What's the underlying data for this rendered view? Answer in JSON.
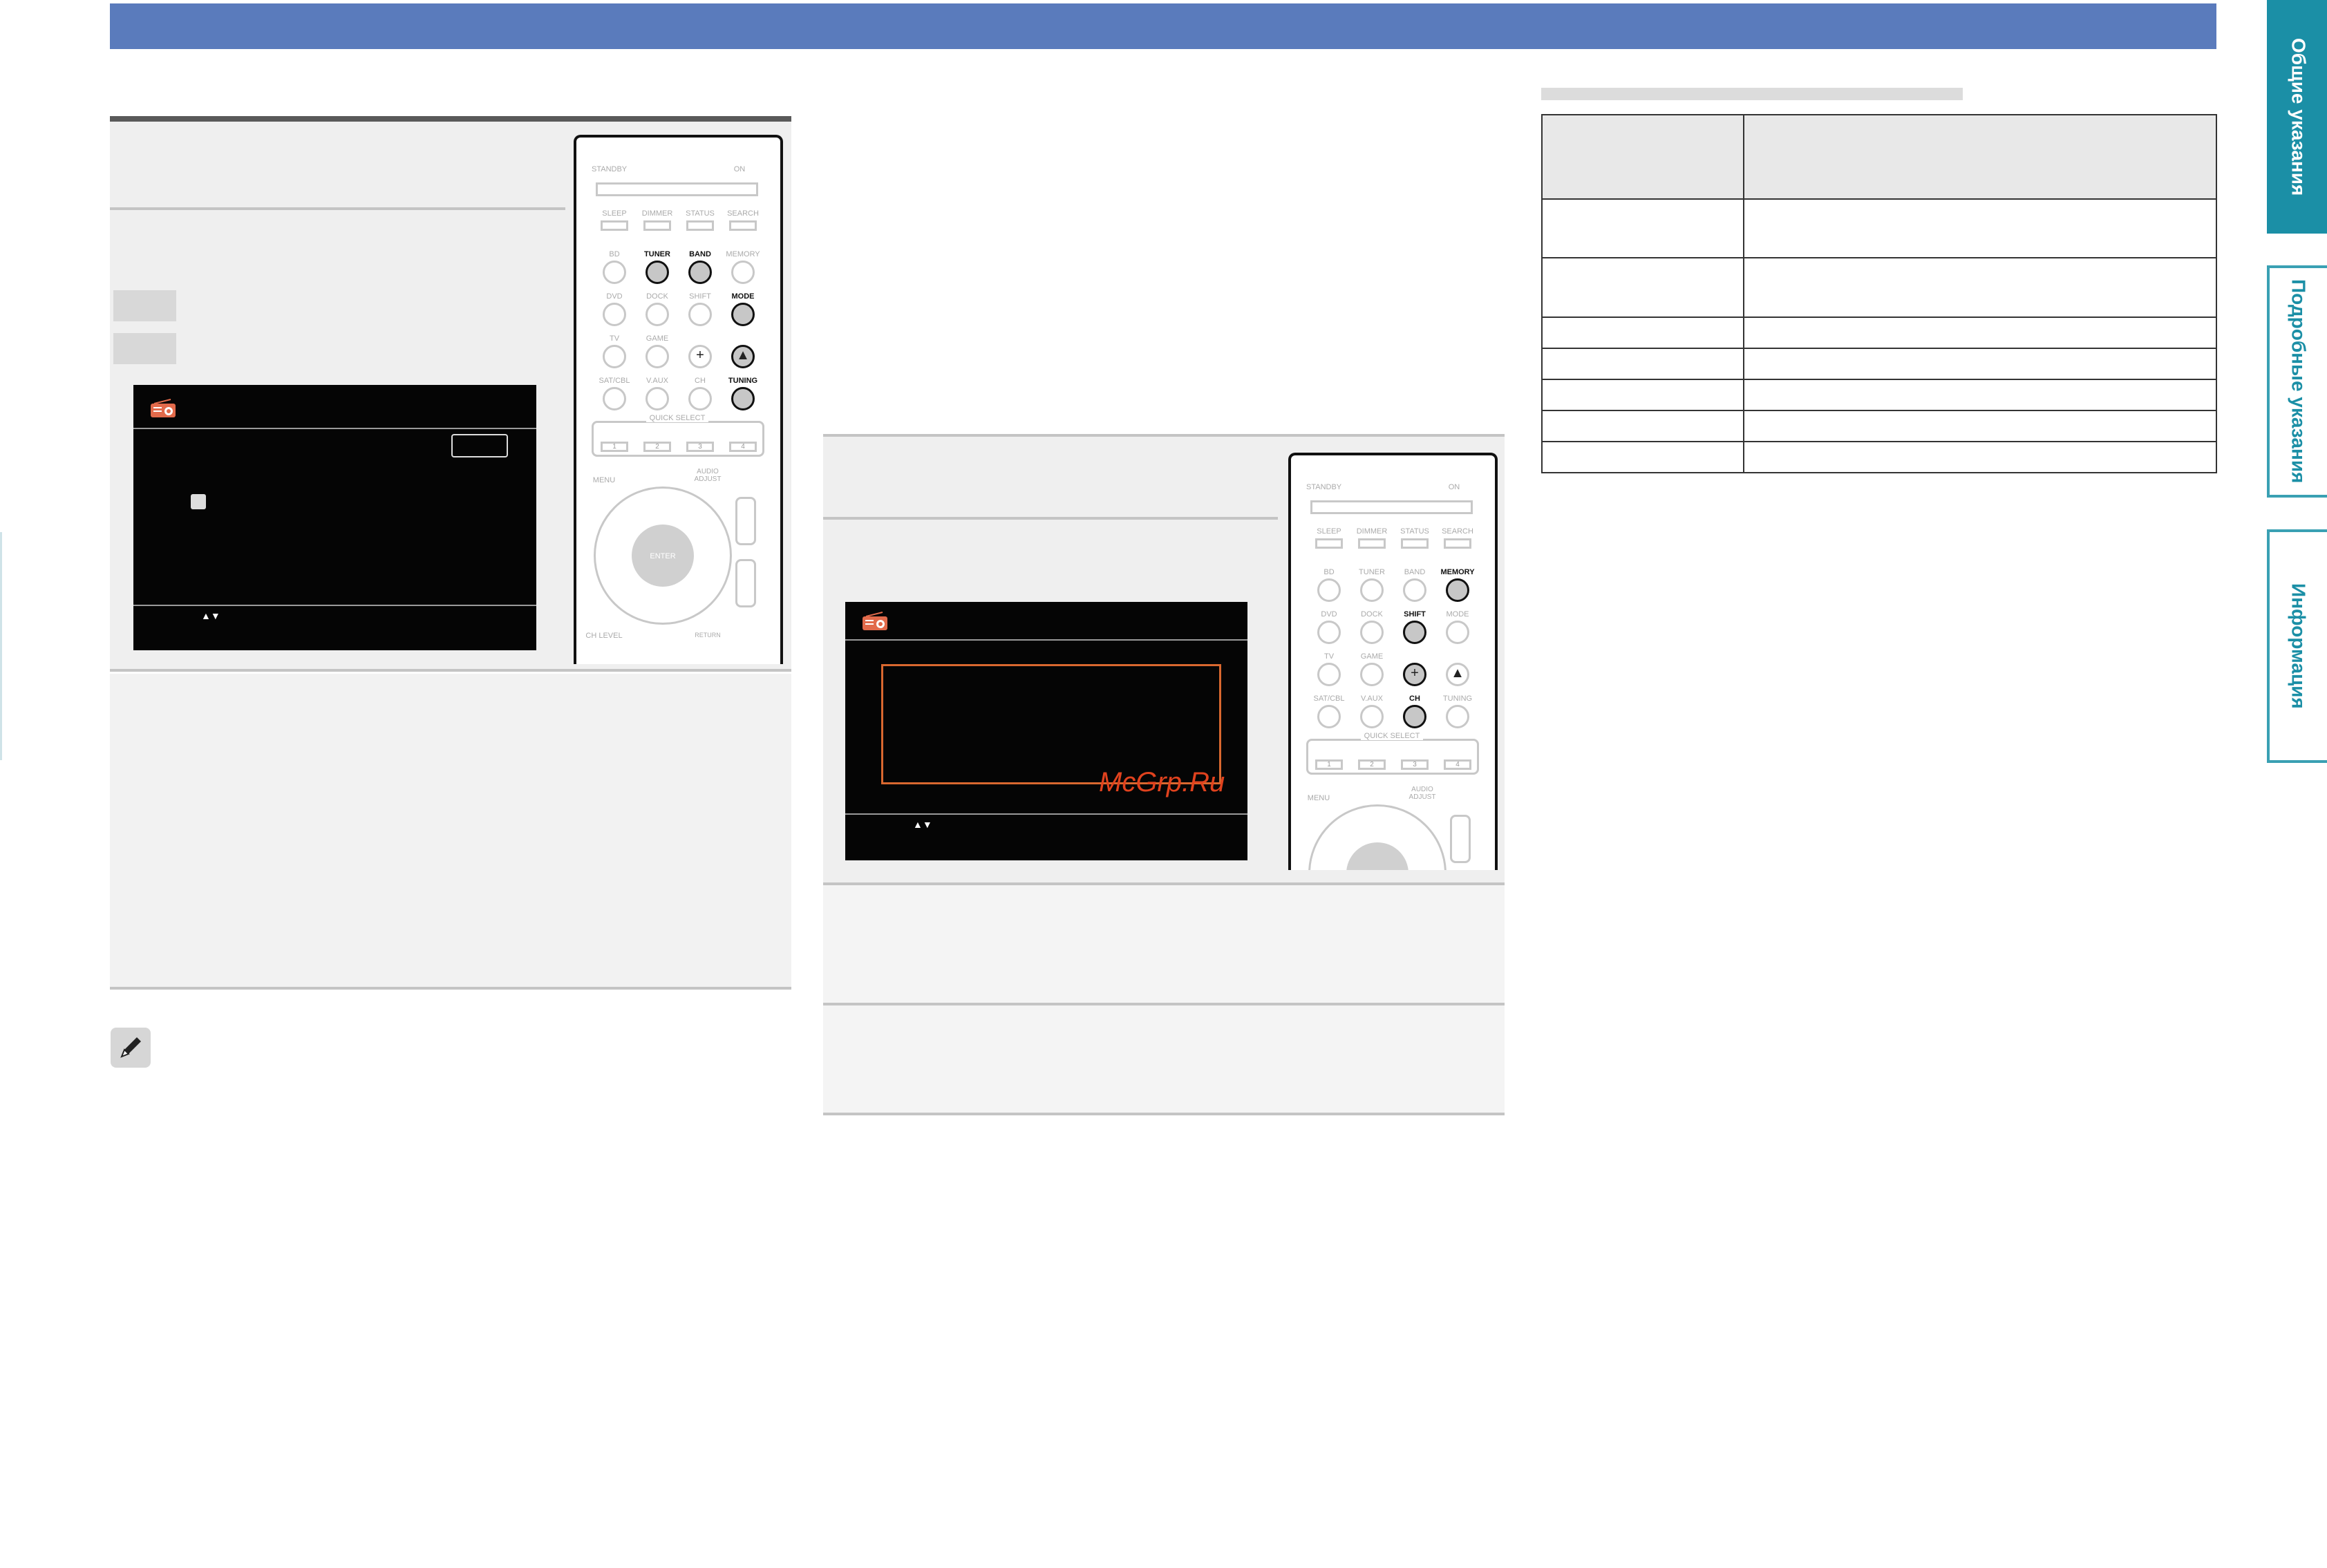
{
  "side_tabs": [
    {
      "label": "Общие указания",
      "active": true
    },
    {
      "label": "Подробные указания",
      "active": false
    },
    {
      "label": "Информация",
      "active": false
    }
  ],
  "remote_left": {
    "top_labels": {
      "standby": "STANDBY",
      "on": "ON"
    },
    "row_labels": [
      "SLEEP",
      "DIMMER",
      "STATUS",
      "SEARCH"
    ],
    "buttons": [
      {
        "label": "BD",
        "hl": false
      },
      {
        "label": "TUNER",
        "hl": true
      },
      {
        "label": "BAND",
        "hl": true
      },
      {
        "label": "MEMORY",
        "hl": false
      },
      {
        "label": "DVD",
        "hl": false
      },
      {
        "label": "DOCK",
        "hl": false
      },
      {
        "label": "SHIFT",
        "hl": false
      },
      {
        "label": "MODE",
        "hl": true
      },
      {
        "label": "TV",
        "hl": false
      },
      {
        "label": "GAME",
        "hl": false
      },
      {
        "label": "+",
        "hl": false
      },
      {
        "label": "▲",
        "hl": true
      },
      {
        "label": "SAT/CBL",
        "hl": false
      },
      {
        "label": "V.AUX",
        "hl": false
      },
      {
        "label": "CH",
        "hl": false
      },
      {
        "label": "TUNING",
        "hl": true
      }
    ],
    "quick_select": "QUICK SELECT",
    "quick_numbers": [
      "1",
      "2",
      "3",
      "4"
    ],
    "menu": "MENU",
    "audio_adjust": "AUDIO ADJUST",
    "enter": "ENTER",
    "ch_level": "CH LEVEL",
    "return": "RETURN"
  },
  "remote_right": {
    "top_labels": {
      "standby": "STANDBY",
      "on": "ON"
    },
    "row_labels": [
      "SLEEP",
      "DIMMER",
      "STATUS",
      "SEARCH"
    ],
    "buttons": [
      {
        "label": "BD",
        "hl": false
      },
      {
        "label": "TUNER",
        "hl": false
      },
      {
        "label": "BAND",
        "hl": false
      },
      {
        "label": "MEMORY",
        "hl": true
      },
      {
        "label": "DVD",
        "hl": false
      },
      {
        "label": "DOCK",
        "hl": false
      },
      {
        "label": "SHIFT",
        "hl": true
      },
      {
        "label": "MODE",
        "hl": false
      },
      {
        "label": "TV",
        "hl": false
      },
      {
        "label": "GAME",
        "hl": false
      },
      {
        "label": "+",
        "hl": true
      },
      {
        "label": "▲",
        "hl": false
      },
      {
        "label": "SAT/CBL",
        "hl": false
      },
      {
        "label": "V.AUX",
        "hl": false
      },
      {
        "label": "CH",
        "hl": true
      },
      {
        "label": "TUNING",
        "hl": false
      }
    ],
    "quick_select": "QUICK SELECT",
    "quick_numbers": [
      "1",
      "2",
      "3",
      "4"
    ],
    "menu": "MENU",
    "audio_adjust": "AUDIO ADJUST"
  },
  "osd": {
    "arrows": "▲▼"
  },
  "watermark": "McGrp.Ru"
}
